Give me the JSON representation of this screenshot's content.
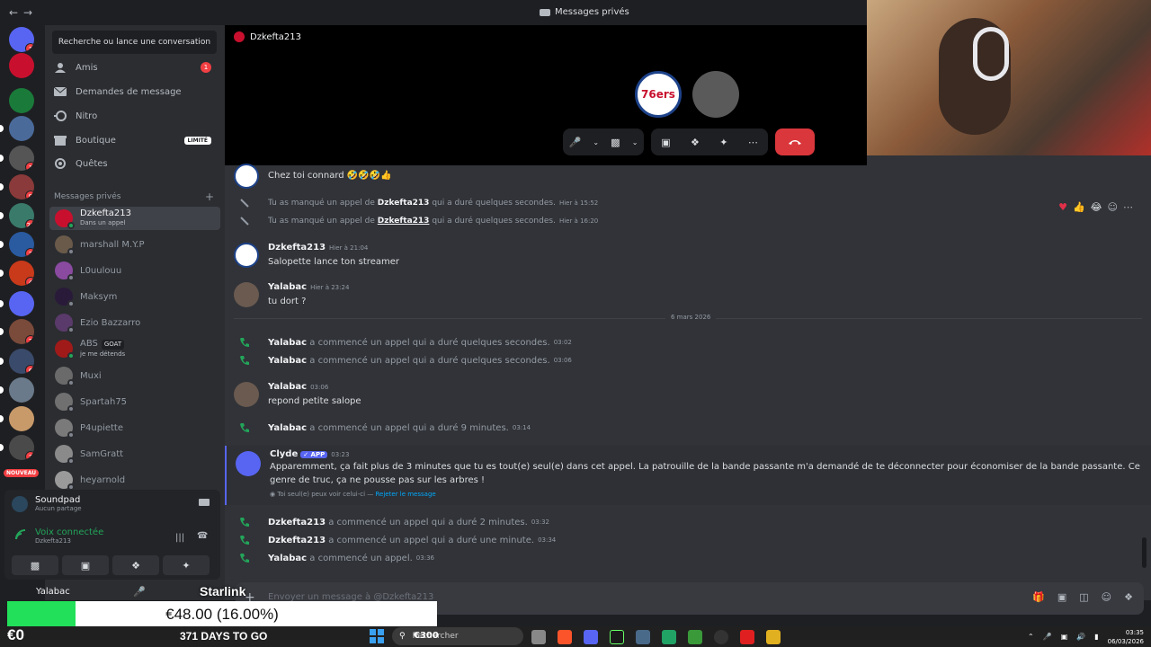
{
  "titlebar": {
    "title": "Messages privés"
  },
  "sidebar": {
    "search_placeholder": "Recherche ou lance une conversation",
    "nav": [
      {
        "label": "Amis",
        "icon": "friends-icon",
        "badge": "1"
      },
      {
        "label": "Demandes de message",
        "icon": "mail-icon"
      },
      {
        "label": "Nitro",
        "icon": "nitro-icon"
      },
      {
        "label": "Boutique",
        "icon": "shop-icon",
        "tag": "LIMITÉ"
      },
      {
        "label": "Quêtes",
        "icon": "quests-icon"
      }
    ],
    "dm_header": "Messages privés",
    "dms": [
      {
        "name": "Dzkefta213",
        "sub": "Dans un appel",
        "color": "#c8102e",
        "online": true
      },
      {
        "name": "marshall M.Y.P",
        "color": "#6a5a4a",
        "online": false
      },
      {
        "name": "L0uulouu",
        "color": "#8a4aa0",
        "online": false
      },
      {
        "name": "Maksym",
        "color": "#2a1a3a",
        "online": false
      },
      {
        "name": "Ezio Bazzarro",
        "color": "#5a3a6a",
        "online": false
      },
      {
        "name": "ABS",
        "tag": "GOAT",
        "sub": "je me détends",
        "color": "#a01a1a",
        "online": true
      },
      {
        "name": "Muxi",
        "color": "#6a6a6a",
        "online": false
      },
      {
        "name": "Spartah75",
        "color": "#707070",
        "online": false
      },
      {
        "name": "P4upiette",
        "color": "#7a7a7a",
        "online": false
      },
      {
        "name": "SamGratt",
        "color": "#8a8a8a",
        "online": false
      },
      {
        "name": "heyarnold",
        "color": "#9a9a9a",
        "online": false
      }
    ],
    "soundpad": {
      "title": "Soundpad",
      "subtitle": "Aucun partage"
    },
    "voice": {
      "title": "Voix connectée",
      "subtitle": "Dzkefta213"
    },
    "user": {
      "name": "Yalabac"
    }
  },
  "servers": [
    {
      "badge": "1",
      "color": "#5865f2"
    },
    {
      "badge": "",
      "color": "#c8102e"
    },
    {
      "badge": "",
      "color": "#1a7a3a"
    },
    {
      "badge": "",
      "color": "#4a6a9a"
    },
    {
      "badge": "1",
      "color": "#555"
    },
    {
      "badge": "9",
      "color": "#8a3a3a"
    },
    {
      "badge": "25",
      "color": "#3a7a6a"
    },
    {
      "badge": "2",
      "color": "#2a5aa0"
    },
    {
      "badge": "4",
      "color": "#c83a1a"
    },
    {
      "badge": "",
      "color": "#5865f2"
    },
    {
      "badge": "2",
      "color": "#7a4a3a"
    },
    {
      "badge": "6",
      "color": "#3a4a6a"
    },
    {
      "badge": "",
      "color": "#6a7a8a"
    },
    {
      "badge": "",
      "color": "#c89a6a"
    },
    {
      "badge": "3",
      "color": "#4a4a4a"
    }
  ],
  "nouveau": "NOUVEAU",
  "call": {
    "channel": "Dzkefta213",
    "self_badge": "76ers"
  },
  "messages": {
    "top_message": "Chez toi connard 🤣🤣🤣👍",
    "missed": [
      {
        "prefix": "Tu as manqué un appel de",
        "who": "Dzkefta213",
        "suffix": "qui a duré quelques secondes.",
        "time": "Hier à 15:52"
      },
      {
        "prefix": "Tu as manqué un appel de",
        "who": "Dzkefta213",
        "suffix": "qui a duré quelques secondes.",
        "time": "Hier à 16:20"
      }
    ],
    "m1": {
      "author": "Dzkefta213",
      "time": "Hier à 21:04",
      "text": "Salopette lance ton streamer"
    },
    "m2": {
      "author": "Yalabac",
      "time": "Hier à 23:24",
      "text": "tu dort ?"
    },
    "date_divider": "6 mars 2026",
    "call1": {
      "who": "Yalabac",
      "text": "a commencé un appel qui a duré quelques secondes.",
      "time": "03:02"
    },
    "call2": {
      "who": "Yalabac",
      "text": "a commencé un appel qui a duré quelques secondes.",
      "time": "03:06"
    },
    "m3": {
      "author": "Yalabac",
      "time": "03:06",
      "text": "repond petite salope"
    },
    "call3": {
      "who": "Yalabac",
      "text": "a commencé un appel qui a duré 9 minutes.",
      "time": "03:14"
    },
    "clyde": {
      "author": "Clyde",
      "tag": "APP",
      "time": "03:23",
      "text": "Apparemment, ça fait plus de 3 minutes que tu es tout(e) seul(e) dans cet appel. La patrouille de la bande passante m'a demandé de te déconnecter pour économiser de la bande passante. Ce genre de truc, ça ne pousse pas sur les arbres !",
      "note": "Toi seul(e) peux voir celui-ci —",
      "dismiss": "Rejeter le message"
    },
    "call4": {
      "who": "Dzkefta213",
      "text": "a commencé un appel qui a duré 2 minutes.",
      "time": "03:32"
    },
    "call5": {
      "who": "Dzkefta213",
      "text": "a commencé un appel qui a duré une minute.",
      "time": "03:34"
    },
    "call6": {
      "who": "Yalabac",
      "text": "a commencé un appel.",
      "time": "03:36"
    }
  },
  "composer": {
    "placeholder": "Envoyer un message à @Dzkefta213"
  },
  "overlay": {
    "text": "€48.00 (16.00%)",
    "progress": 0.16,
    "starlink": "Starlink",
    "euro0": "€0",
    "days": "371 DAYS TO GO",
    "e300": "€300"
  },
  "taskbar": {
    "search": "Rechercher",
    "time": "03:35",
    "date": "06/03/2026"
  }
}
